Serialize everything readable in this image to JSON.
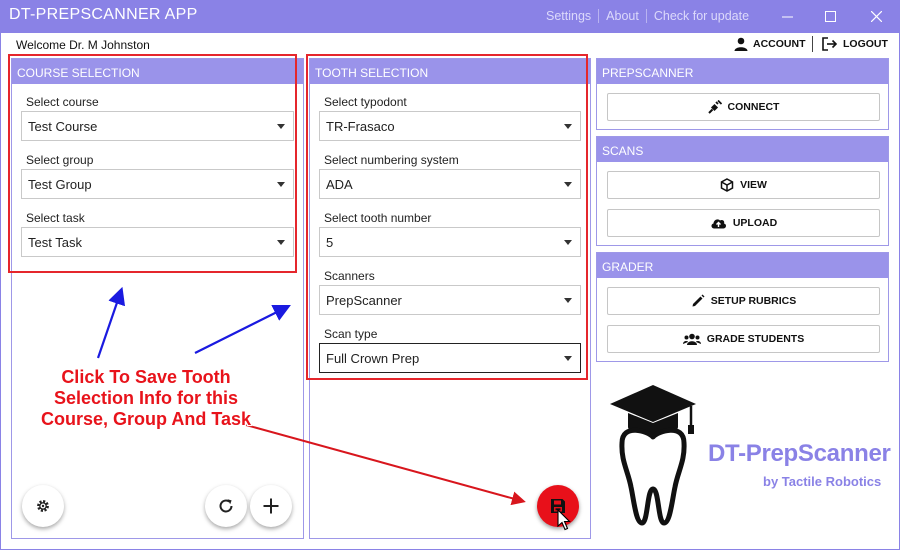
{
  "app": {
    "title": "DT-PREPSCANNER APP",
    "menu": [
      "Settings",
      "About",
      "Check for update"
    ],
    "window_controls": [
      "minimize-icon",
      "maximize-icon",
      "close-icon"
    ]
  },
  "header": {
    "welcome": "Welcome Dr. M Johnston",
    "account_label": "ACCOUNT",
    "logout_label": "LOGOUT"
  },
  "course_selection": {
    "title": "COURSE SELECTION",
    "fields": [
      {
        "label": "Select course",
        "value": "Test Course"
      },
      {
        "label": "Select group",
        "value": "Test Group"
      },
      {
        "label": "Select task",
        "value": "Test Task"
      }
    ]
  },
  "tooth_selection": {
    "title": "TOOTH SELECTION",
    "fields": [
      {
        "label": "Select typodont",
        "value": "TR-Frasaco"
      },
      {
        "label": "Select numbering system",
        "value": "ADA"
      },
      {
        "label": "Select tooth number",
        "value": "5"
      },
      {
        "label": "Scanners",
        "value": "PrepScanner"
      },
      {
        "label": "Scan type",
        "value": "Full Crown Prep"
      }
    ]
  },
  "prepscanner": {
    "title": "PREPSCANNER",
    "connect_label": "CONNECT"
  },
  "scans": {
    "title": "SCANS",
    "view_label": "VIEW",
    "upload_label": "UPLOAD"
  },
  "grader": {
    "title": "GRADER",
    "setup_rubrics_label": "SETUP RUBRICS",
    "grade_students_label": "GRADE STUDENTS"
  },
  "brand": {
    "name": "DT-PrepScanner",
    "tagline": "by Tactile Robotics"
  },
  "annotation": {
    "text": "Click To Save Tooth Selection Info for this Course, Group And Task"
  },
  "colors": {
    "accent": "#8a82e6",
    "panel_header": "#9a93ea",
    "annotation_red": "#e8131b",
    "arrow_blue": "#1a1ae0"
  },
  "icons": {
    "account": "person-icon",
    "logout": "logout-icon",
    "connect": "plug-icon",
    "view": "cube-icon",
    "upload": "cloud-upload-icon",
    "setup_rubrics": "pencil-icon",
    "grade_students": "users-icon",
    "settings": "gear-icon",
    "refresh": "refresh-icon",
    "add": "plus-icon",
    "save": "floppy-disk-icon"
  }
}
